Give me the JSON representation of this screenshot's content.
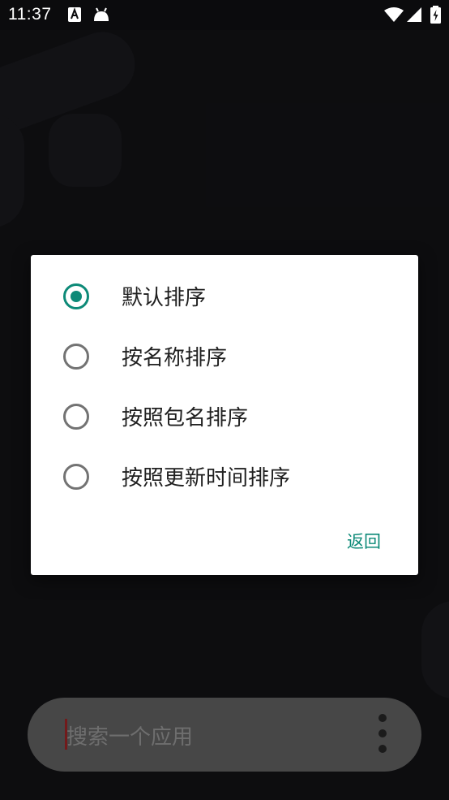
{
  "status_bar": {
    "time": "11:37",
    "icons": [
      "accessibility-a-icon",
      "android-icon",
      "wifi-icon",
      "signal-icon",
      "battery-charging-icon"
    ]
  },
  "dialog": {
    "options": [
      {
        "label": "默认排序",
        "checked": true
      },
      {
        "label": "按名称排序",
        "checked": false
      },
      {
        "label": "按照包名排序",
        "checked": false
      },
      {
        "label": "按照更新时间排序",
        "checked": false
      }
    ],
    "back_label": "返回"
  },
  "search": {
    "placeholder": "搜索一个应用"
  },
  "colors": {
    "accent": "#0d8a78",
    "background": "#141418",
    "dialog": "#ffffff"
  }
}
